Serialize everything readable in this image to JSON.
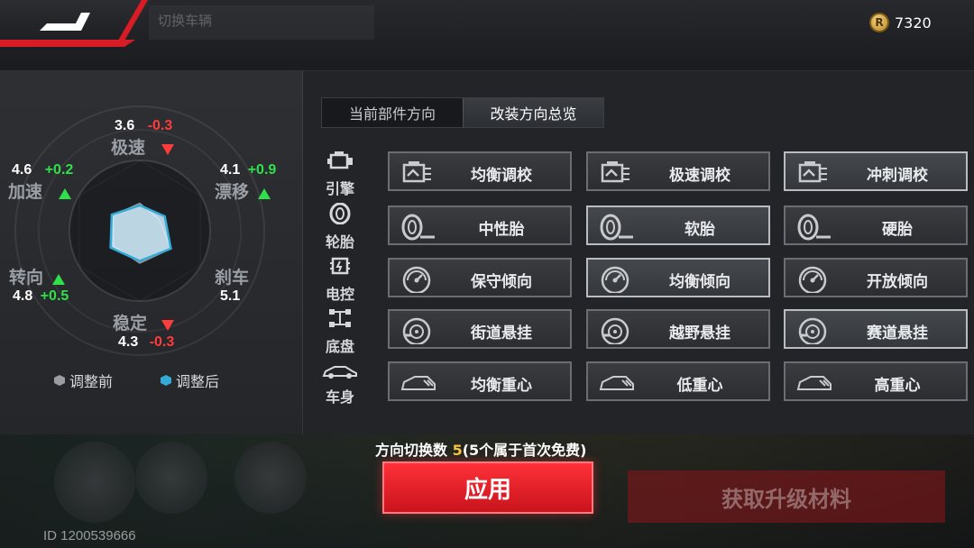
{
  "header": {
    "back_icon": "back-arrow-icon",
    "ghost_tab_label": "切换车辆",
    "currency_amount": "7320",
    "currency_icon": "coin-icon"
  },
  "radar": {
    "stats": [
      {
        "key": "top_speed",
        "name": "极速",
        "value": "3.6",
        "delta": "-0.3",
        "trend": "down"
      },
      {
        "key": "drift",
        "name": "漂移",
        "value": "4.1",
        "delta": "+0.9",
        "trend": "up"
      },
      {
        "key": "brake",
        "name": "刹车",
        "value": "5.1",
        "delta": "",
        "trend": "none"
      },
      {
        "key": "stability",
        "name": "稳定",
        "value": "4.3",
        "delta": "-0.3",
        "trend": "down"
      },
      {
        "key": "steering",
        "name": "转向",
        "value": "4.8",
        "delta": "+0.5",
        "trend": "up"
      },
      {
        "key": "acceleration",
        "name": "加速",
        "value": "4.6",
        "delta": "+0.2",
        "trend": "up"
      }
    ],
    "legend": {
      "before": "调整前",
      "after": "调整后"
    },
    "colors": {
      "before": "#9a9ea3",
      "after": "#35a9d6"
    }
  },
  "tabs": [
    {
      "label": "当前部件方向",
      "active": false
    },
    {
      "label": "改装方向总览",
      "active": true
    }
  ],
  "categories": [
    {
      "label": "引擎",
      "icon": "engine-icon",
      "options": [
        {
          "label": "均衡调校",
          "icon": "engine-part-icon",
          "selected": false
        },
        {
          "label": "极速调校",
          "icon": "engine-part-icon",
          "selected": false
        },
        {
          "label": "冲刺调校",
          "icon": "engine-part-icon",
          "selected": true
        }
      ]
    },
    {
      "label": "轮胎",
      "icon": "tire-icon",
      "options": [
        {
          "label": "中性胎",
          "icon": "tire-part-icon",
          "selected": false
        },
        {
          "label": "软胎",
          "icon": "tire-part-icon",
          "selected": true
        },
        {
          "label": "硬胎",
          "icon": "tire-part-icon",
          "selected": false
        }
      ]
    },
    {
      "label": "电控",
      "icon": "chip-icon",
      "options": [
        {
          "label": "保守倾向",
          "icon": "gauge-icon",
          "selected": false
        },
        {
          "label": "均衡倾向",
          "icon": "gauge-icon",
          "selected": true
        },
        {
          "label": "开放倾向",
          "icon": "gauge-icon",
          "selected": false
        }
      ]
    },
    {
      "label": "底盘",
      "icon": "chassis-icon",
      "options": [
        {
          "label": "街道悬挂",
          "icon": "brake-disc-icon",
          "selected": false
        },
        {
          "label": "越野悬挂",
          "icon": "brake-disc-icon",
          "selected": false
        },
        {
          "label": "赛道悬挂",
          "icon": "brake-disc-icon",
          "selected": true
        }
      ]
    },
    {
      "label": "车身",
      "icon": "car-body-icon",
      "options": [
        {
          "label": "均衡重心",
          "icon": "car-body-part-icon",
          "selected": false
        },
        {
          "label": "低重心",
          "icon": "car-body-part-icon",
          "selected": false
        },
        {
          "label": "高重心",
          "icon": "car-body-part-icon",
          "selected": false
        }
      ]
    }
  ],
  "footer": {
    "switch_prefix": "方向切换数",
    "switch_count": "5",
    "switch_suffix": "(5个属于首次免费)",
    "apply_label": "应用",
    "material_label": "获取升级材料",
    "player_id": "ID 1200539666"
  }
}
